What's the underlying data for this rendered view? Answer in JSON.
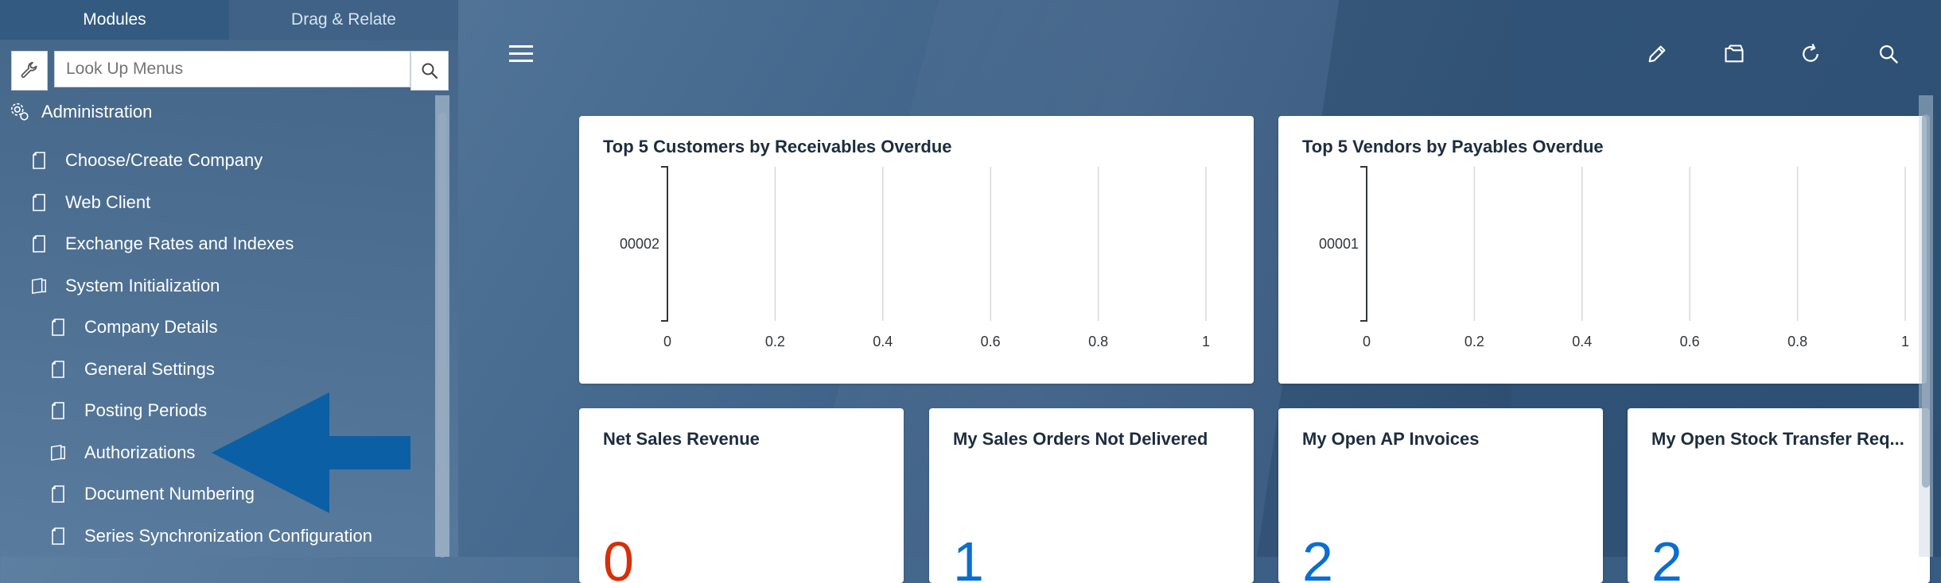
{
  "sidebar": {
    "tabs": [
      {
        "label": "Modules",
        "active": true
      },
      {
        "label": "Drag & Relate",
        "active": false
      }
    ],
    "search": {
      "placeholder": "Look Up Menus"
    },
    "root": {
      "label": "Administration",
      "icon": "admin-gear-icon"
    },
    "items": [
      {
        "label": "Choose/Create Company",
        "level": 1,
        "icon": "document-icon"
      },
      {
        "label": "Web Client",
        "level": 1,
        "icon": "document-icon"
      },
      {
        "label": "Exchange Rates and Indexes",
        "level": 1,
        "icon": "document-icon"
      },
      {
        "label": "System Initialization",
        "level": 1,
        "icon": "folder-documents-icon"
      },
      {
        "label": "Company Details",
        "level": 2,
        "icon": "document-icon"
      },
      {
        "label": "General Settings",
        "level": 2,
        "icon": "document-icon"
      },
      {
        "label": "Posting Periods",
        "level": 2,
        "icon": "document-icon"
      },
      {
        "label": "Authorizations",
        "level": 2,
        "icon": "folder-documents-icon"
      },
      {
        "label": "Document Numbering",
        "level": 2,
        "icon": "document-icon"
      },
      {
        "label": "Series Synchronization Configuration",
        "level": 2,
        "icon": "document-icon"
      }
    ]
  },
  "toolbar": {
    "icons": [
      "menu-icon",
      "edit-icon",
      "folder-icon",
      "refresh-icon",
      "search-icon"
    ]
  },
  "cards": {
    "customers": {
      "title": "Top 5 Customers by Receivables Overdue"
    },
    "vendors": {
      "title": "Top 5 Vendors by Payables Overdue"
    },
    "net_sales": {
      "title": "Net Sales Revenue",
      "value": "0",
      "color": "#d62f0a"
    },
    "sales_orders": {
      "title": "My Sales Orders Not Delivered",
      "value": "1",
      "color": "#0a6ed1"
    },
    "ap_invoices": {
      "title": "My Open AP Invoices",
      "value": "2",
      "color": "#0a6ed1"
    },
    "stock_transfer": {
      "title": "My Open Stock Transfer Req...",
      "value": "2",
      "color": "#0a6ed1"
    }
  },
  "chart_data": [
    {
      "type": "bar",
      "title": "Top 5 Customers by Receivables Overdue",
      "categories": [
        "00002"
      ],
      "values": [
        0
      ],
      "xlim": [
        0,
        1
      ],
      "xticks": [
        "0",
        "0.2",
        "0.4",
        "0.6",
        "0.8",
        "1"
      ],
      "orientation": "horizontal",
      "grid": true
    },
    {
      "type": "bar",
      "title": "Top 5 Vendors by Payables Overdue",
      "categories": [
        "00001"
      ],
      "values": [
        0
      ],
      "xlim": [
        0,
        1
      ],
      "xticks": [
        "0",
        "0.2",
        "0.4",
        "0.6",
        "0.8",
        "1"
      ],
      "orientation": "horizontal",
      "grid": true
    }
  ]
}
